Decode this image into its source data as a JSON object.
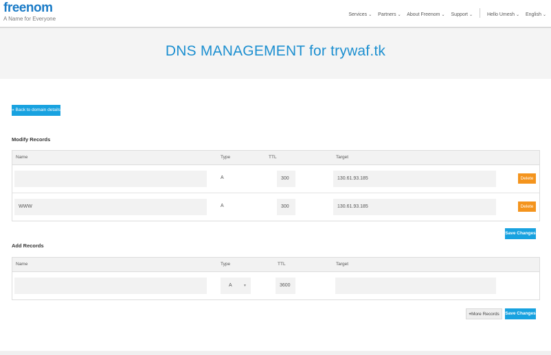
{
  "header": {
    "logo_text": "freenom",
    "tagline": "A Name for Everyone",
    "nav": [
      {
        "label": "Services"
      },
      {
        "label": "Partners"
      },
      {
        "label": "About Freenom"
      },
      {
        "label": "Support"
      }
    ],
    "user": "Hello Umesh",
    "language": "English"
  },
  "page_title": "DNS MANAGEMENT for trywaf.tk",
  "back_button": "« Back to domain details",
  "modify": {
    "title": "Modify Records",
    "columns": {
      "name": "Name",
      "type": "Type",
      "ttl": "TTL",
      "target": "Target"
    },
    "rows": [
      {
        "name": "",
        "type": "A",
        "ttl": "300",
        "target": "130.61.93.185",
        "delete": "Delete"
      },
      {
        "name": "WWW",
        "type": "A",
        "ttl": "300",
        "target": "130.61.93.185",
        "delete": "Delete"
      }
    ],
    "save": "Save Changes"
  },
  "add": {
    "title": "Add Records",
    "columns": {
      "name": "Name",
      "type": "Type",
      "ttl": "TTL",
      "target": "Target"
    },
    "row": {
      "name": "",
      "type": "A",
      "ttl": "3600",
      "target": ""
    },
    "more": "More Records",
    "save": "Save Changes"
  },
  "colors": {
    "accent": "#18a2e0",
    "delete": "#f4941d",
    "title": "#1c8fd0"
  }
}
